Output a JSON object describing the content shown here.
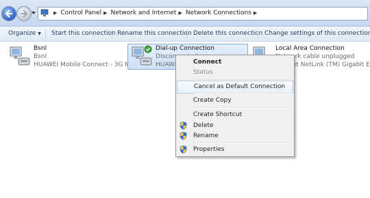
{
  "address_bar": {
    "crumbs": [
      "Control Panel",
      "Network and Internet",
      "Network Connections"
    ]
  },
  "command_bar": {
    "items": [
      "Organize",
      "Start this connection",
      "Rename this connection",
      "Delete this connection",
      "Change settings of this connection"
    ]
  },
  "connections": [
    {
      "name": "Bsnl",
      "line2": "Bsnl",
      "line3": "HUAWEI Mobile Connect - 3G M..."
    },
    {
      "name": "Dial-up Connection",
      "line2": "Disconnected",
      "line3": "HUAWEI"
    },
    {
      "name": "Local Area Connection",
      "line2": "Network cable unplugged",
      "line3": "Atheros AR8132 PCI-E Fast Ethernet NetLink (TM) Gigabit E..."
    }
  ],
  "context_menu": {
    "items": [
      "Connect",
      "Status",
      "Cancel as Default Connection",
      "Create Copy",
      "Create Shortcut",
      "Delete",
      "Rename",
      "Properties"
    ]
  },
  "colors": {
    "accent": "#1e395b",
    "selection": "#cfe0f6",
    "menu_hover_border": "#aeccf1"
  }
}
